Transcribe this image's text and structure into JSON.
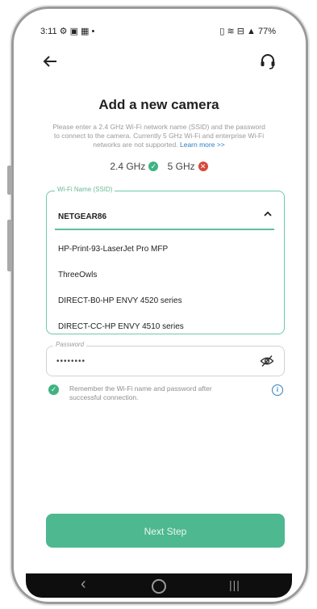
{
  "status_bar": {
    "time": "3:11",
    "left_icons": "⚙ ▣ ▦ •",
    "right_icons": "▯ ≋ ⊟ ▲",
    "battery": "77%"
  },
  "header": {
    "back_icon": "arrow-left-icon",
    "support_icon": "headset-icon"
  },
  "page": {
    "title": "Add a new camera",
    "description": "Please enter a 2.4 GHz Wi-Fi network name (SSID) and the password to connect to the camera. Currently 5 GHz Wi-Fi and enterprise Wi-Fi networks are not supported.",
    "learn_more": "Learn more >>"
  },
  "bands": {
    "band_24": "2.4 GHz",
    "band_5": "5 GHz"
  },
  "ssid_field": {
    "label": "Wi-Fi Name (SSID)",
    "selected": "NETGEAR86",
    "options": [
      "HP-Print-93-LaserJet Pro MFP",
      "ThreeOwls",
      "DIRECT-B0-HP ENVY 4520 series",
      "DIRECT-CC-HP ENVY 4510 series"
    ]
  },
  "password_field": {
    "label": "Password",
    "value": "••••••••"
  },
  "remember": {
    "text": "Remember the Wi-Fi name and password after successful connection."
  },
  "next_button": {
    "label": "Next Step"
  },
  "colors": {
    "accent": "#4eb890",
    "success": "#3fb382",
    "error": "#d9463b",
    "link": "#2d7fc1"
  }
}
